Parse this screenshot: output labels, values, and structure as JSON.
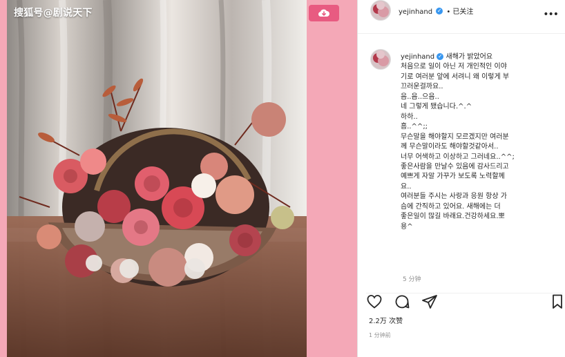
{
  "watermark": "搜狐号@剧说天下",
  "post": {
    "username": "yejinhand",
    "verified_mark": "✓",
    "follow_state": "• 已关注",
    "menu": "•••",
    "caption_lines": [
      "새해가 밝았어요",
      "처음으로 일이 아닌 저 개인적인 이야",
      "기로 여러분 앞에 서려니 왜 이렇게 부",
      "끄러운걸까요..",
      "음..음..으음..",
      "네 그렇게 됐습니다.^.^",
      "하하..",
      "흠..^^;;",
      "무슨말을 해야할지 모르겠지만 여러분",
      "께 무슨말이라도 해야할것같아서..",
      "너무 어색하고 이상하고 그러네요..^^;",
      "좋은사람을 만날수 있음에 감사드리고",
      "예쁘게 자알 가꾸가 보도록 노력할께",
      "요..",
      "여러분들 주시는 사랑과 응원 항상 가",
      "슴에 간직하고 있어요. 새해에는 더",
      "좋은일이 많길 바래요.건강하세요.뽀",
      "용^"
    ],
    "time_ago": "5 分钟",
    "likes": "2.2万 次赞",
    "date": "1 分钟前"
  },
  "icons": {
    "cloud": "cloud-download-icon",
    "heart": "heart-icon",
    "comment": "comment-icon",
    "share": "share-icon",
    "bookmark": "bookmark-icon"
  },
  "colors": {
    "background_pink": "#f4a8b7",
    "accent_pink": "#e85b81",
    "verified_blue": "#3897f0"
  }
}
